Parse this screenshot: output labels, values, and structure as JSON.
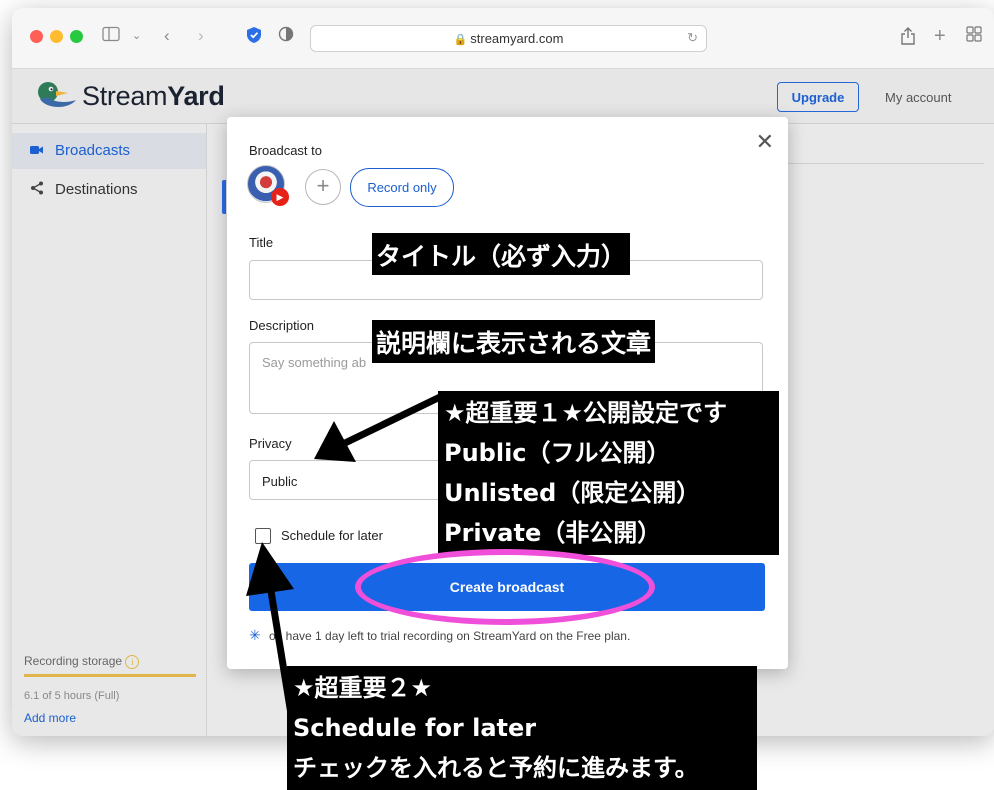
{
  "browser": {
    "url": "streamyard.com"
  },
  "app": {
    "logo_light": "Stream",
    "logo_bold": "Yard",
    "upgrade_label": "Upgrade",
    "account_label": "My account"
  },
  "sidebar": {
    "items": [
      {
        "label": "Broadcasts",
        "icon": "video-camera-icon"
      },
      {
        "label": "Destinations",
        "icon": "share-icon"
      }
    ],
    "storage_label": "Recording storage",
    "storage_value": "6.1 of 5 hours (Full)",
    "add_more": "Add more"
  },
  "modal": {
    "broadcast_to_label": "Broadcast to",
    "record_only_label": "Record only",
    "title_label": "Title",
    "title_value": "",
    "description_label": "Description",
    "description_placeholder": "Say something ab",
    "privacy_label": "Privacy",
    "privacy_value": "Public",
    "schedule_label": "Schedule for later",
    "schedule_checked": false,
    "create_label": "Create broadcast",
    "trial_text": "ou have 1 day left to trial recording on StreamYard on the Free plan."
  },
  "annotations": {
    "title_note": "タイトル（必ず入力）",
    "description_note": "説明欄に表示される文章",
    "privacy_note": [
      "★超重要１★公開設定です",
      "Public（フル公開）",
      "Unlisted（限定公開）",
      "Private（非公開）"
    ],
    "schedule_note": [
      "★超重要２★",
      "Schedule for later",
      "チェックを入れると予約に進みます。"
    ],
    "highlight_color": "#ef4fd9"
  }
}
